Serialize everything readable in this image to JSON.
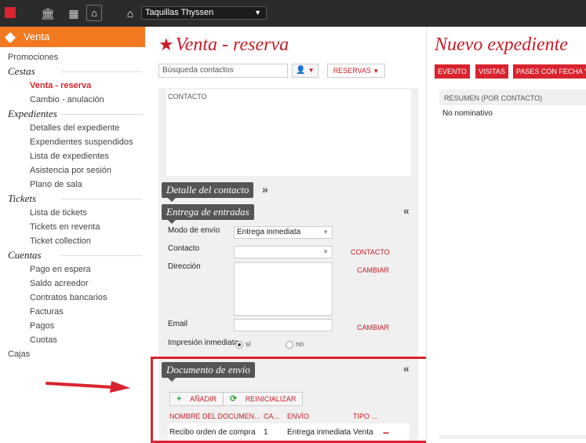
{
  "topbar": {
    "select_value": "Taquillas Thyssen",
    "icons": [
      "red-square",
      "bank-icon",
      "building-icon",
      "home-icon",
      "home-icon"
    ]
  },
  "sidebar": {
    "head": "Venta",
    "items": [
      {
        "type": "top",
        "label": "Promociones"
      },
      {
        "type": "section",
        "label": "Cestas"
      },
      {
        "type": "item",
        "label": "Venta - reserva",
        "active": true
      },
      {
        "type": "item",
        "label": "Cambio - anulación"
      },
      {
        "type": "section",
        "label": "Expedientes"
      },
      {
        "type": "item",
        "label": "Detalles del expediente"
      },
      {
        "type": "item",
        "label": "Expendientes suspendidos"
      },
      {
        "type": "item",
        "label": "Lista de expedientes"
      },
      {
        "type": "item",
        "label": "Asistencia por sesión"
      },
      {
        "type": "item",
        "label": "Plano de sala"
      },
      {
        "type": "section",
        "label": "Tickets"
      },
      {
        "type": "item",
        "label": "Lista de tickets"
      },
      {
        "type": "item",
        "label": "Tickets en reventa"
      },
      {
        "type": "item",
        "label": "Ticket collection"
      },
      {
        "type": "section",
        "label": "Cuentas"
      },
      {
        "type": "item",
        "label": "Pago en espera"
      },
      {
        "type": "item",
        "label": "Saldo acreedor"
      },
      {
        "type": "item",
        "label": "Contratos bancarios"
      },
      {
        "type": "item",
        "label": "Facturas"
      },
      {
        "type": "item",
        "label": "Pagos"
      },
      {
        "type": "item",
        "label": "Cuotas"
      },
      {
        "type": "top",
        "label": "Cajas"
      }
    ]
  },
  "main": {
    "title": "Venta - reserva",
    "search_placeholder": "Búsqueda contactos",
    "reservas_label": "RESERVAS",
    "contacto_label": "CONTACTO",
    "detalle_tab": "Detalle del contacto",
    "entrega_tab": "Entrega de entradas",
    "modo_envio_label": "Modo de envío",
    "modo_envio_value": "Entrega inmediata",
    "contacto_field_label": "Contacto",
    "contacto_link": "CONTACTO",
    "direccion_label": "Dirección",
    "cambiar_link": "CAMBIAR",
    "email_label": "Email",
    "impresion_label": "Impresión inmediata",
    "radio_si": "sí",
    "radio_no": "no",
    "documento_tab": "Documento de envío",
    "anadir_label": "AÑADIR",
    "reinicializar_label": "REINICIALIZAR",
    "table": {
      "headers": [
        "NOMBRE DEL DOCUMEN...",
        "CA...",
        "ENVÍO",
        "TIPO ..."
      ],
      "rows": [
        [
          "Recibo orden de compra",
          "1",
          "Entrega inmediata",
          "Venta"
        ]
      ]
    }
  },
  "right": {
    "title": "Nuevo expediente",
    "buttons": [
      "EVENTO",
      "VISITAS",
      "PASES CON FECHA Y"
    ],
    "resumen_label": "RESUMEN (POR CONTACTO)",
    "resumen_value": "No nominativo"
  },
  "colors": {
    "accent_red": "#d9232e",
    "orange": "#f2791f",
    "dark": "#2b2b2b"
  }
}
